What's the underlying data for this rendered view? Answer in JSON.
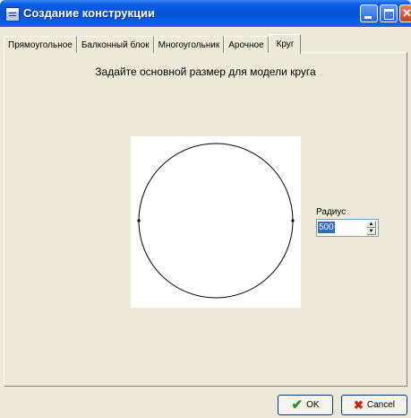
{
  "window": {
    "title": "Создание конструкции"
  },
  "tabs": [
    {
      "label": "Прямоугольное"
    },
    {
      "label": "Балконный блок"
    },
    {
      "label": "Многоугольник"
    },
    {
      "label": "Арочное"
    },
    {
      "label": "Круг",
      "active": true
    }
  ],
  "main": {
    "prompt": "Задайте основной размер для модели круга",
    "radius_label": "Радиус",
    "radius_value": "500"
  },
  "buttons": {
    "ok": "OK",
    "cancel": "Cancel"
  },
  "icons": {
    "ok": "check-icon",
    "cancel": "cross-icon"
  },
  "colors": {
    "titlebar": "#0352d8",
    "selection": "#316ac5",
    "ok_icon": "#2e8b1a",
    "cancel_icon": "#c8220e"
  }
}
